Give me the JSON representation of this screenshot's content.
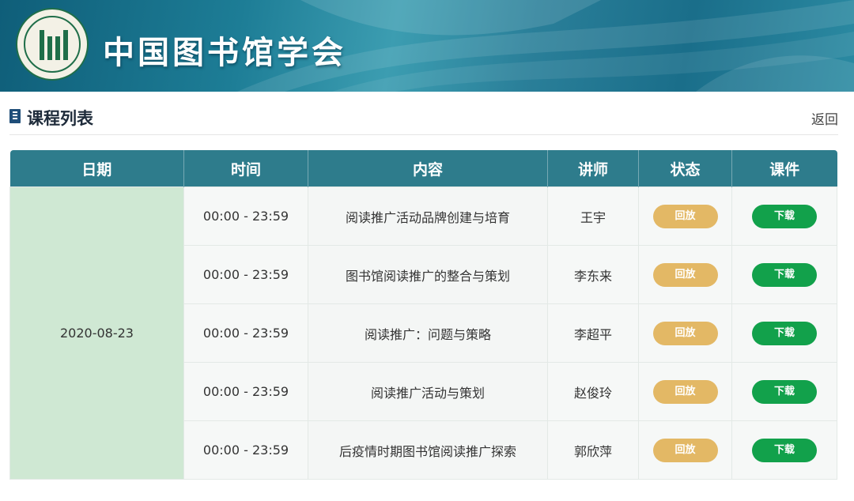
{
  "header": {
    "site_title": "中国图书馆学会",
    "logo_icon": "library-society-logo-icon"
  },
  "section": {
    "title": "课程列表",
    "back_label": "返回",
    "icon": "document-icon"
  },
  "table": {
    "columns": [
      "日期",
      "时间",
      "内容",
      "讲师",
      "状态",
      "课件"
    ],
    "date": "2020-08-23",
    "rows": [
      {
        "time": "00:00 - 23:59",
        "content": "阅读推广活动品牌创建与培育",
        "lecturer": "王宇",
        "status": "回放",
        "file": "下载"
      },
      {
        "time": "00:00 - 23:59",
        "content": "图书馆阅读推广的整合与策划",
        "lecturer": "李东来",
        "status": "回放",
        "file": "下载"
      },
      {
        "time": "00:00 - 23:59",
        "content": "阅读推广：问题与策略",
        "lecturer": "李超平",
        "status": "回放",
        "file": "下载"
      },
      {
        "time": "00:00 - 23:59",
        "content": "阅读推广活动与策划",
        "lecturer": "赵俊玲",
        "status": "回放",
        "file": "下载"
      },
      {
        "time": "00:00 - 23:59",
        "content": "后疫情时期图书馆阅读推广探索",
        "lecturer": "郭欣萍",
        "status": "回放",
        "file": "下载"
      }
    ]
  },
  "colors": {
    "header_bg": "#2e7c8c",
    "date_cell_bg": "#cfe8d3",
    "replay_button": "#e3b865",
    "download_button": "#12a14b"
  }
}
